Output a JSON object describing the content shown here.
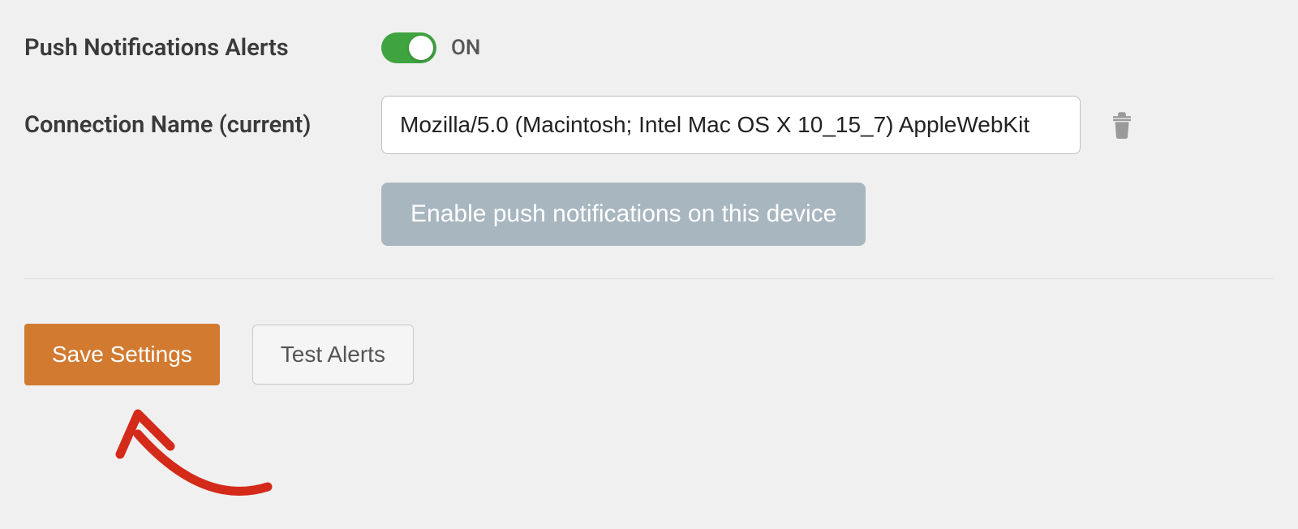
{
  "settings": {
    "push_notifications": {
      "label": "Push Notifications Alerts",
      "state_text": "ON",
      "enabled": true
    },
    "connection": {
      "label": "Connection Name (current)",
      "value": "Mozilla/5.0 (Macintosh; Intel Mac OS X 10_15_7) AppleWebKit"
    },
    "enable_button": "Enable push notifications on this device"
  },
  "actions": {
    "save": "Save Settings",
    "test": "Test Alerts"
  },
  "colors": {
    "toggle_on": "#3fa33f",
    "primary_button": "#d27a30",
    "disabled_button": "#a8b6bf",
    "annotation": "#d42a1a"
  }
}
